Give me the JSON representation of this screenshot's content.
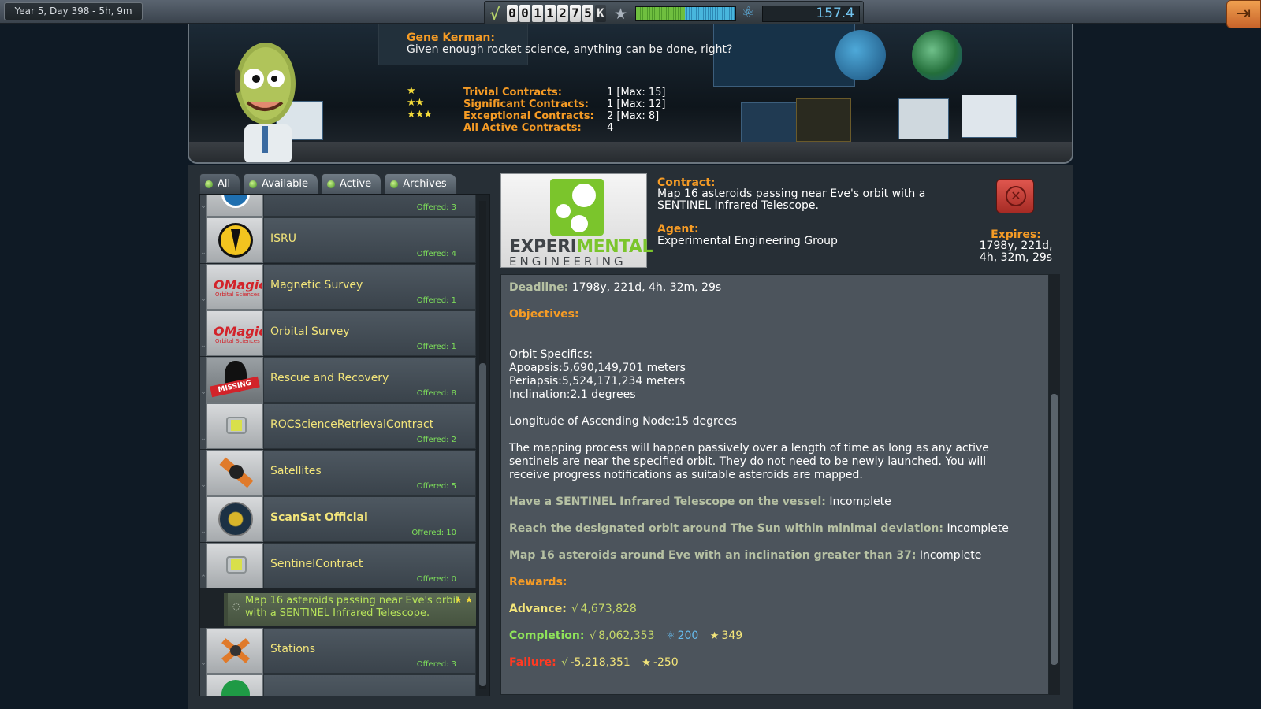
{
  "topbar": {
    "date": "Year 5, Day 398 - 5h, 9m",
    "funds_digits": [
      "0",
      "0",
      "1",
      "1",
      "2",
      "7",
      "5",
      "K"
    ],
    "science": "157.4",
    "reputation_level": 0.55,
    "icons": {
      "funds": "funds-icon",
      "reputation": "star-icon",
      "science": "science-atom-icon",
      "exit": "exit-icon"
    }
  },
  "header": {
    "speaker": "Gene Kerman:",
    "quote": "Given enough rocket science, anything can be done, right?",
    "summary": [
      {
        "stars": "★",
        "label": "Trivial Contracts:",
        "value": "1  [Max: 15]"
      },
      {
        "stars": "★★",
        "label": "Significant Contracts:",
        "value": "1  [Max: 12]"
      },
      {
        "stars": "★★★",
        "label": "Exceptional Contracts:",
        "value": "2  [Max: 8]"
      },
      {
        "stars": "",
        "label": "All Active Contracts:",
        "value": "4"
      }
    ]
  },
  "tabs": [
    "All",
    "Available",
    "Active",
    "Archives"
  ],
  "list": {
    "rows": [
      {
        "title": "",
        "offered": "Offered: 3",
        "icon": "agency-logo-icon"
      },
      {
        "title": "ISRU",
        "offered": "Offered: 4",
        "icon": "isru-drill-icon"
      },
      {
        "title": "Magnetic Survey",
        "offered": "Offered: 1",
        "icon": "omagic-logo-icon"
      },
      {
        "title": "Orbital Survey",
        "offered": "Offered: 1",
        "icon": "omagic-logo-icon"
      },
      {
        "title": "Rescue and Recovery",
        "offered": "Offered: 8",
        "icon": "missing-kerbal-icon"
      },
      {
        "title": "ROCScienceRetrievalContract",
        "offered": "Offered: 2",
        "icon": "probe-icon"
      },
      {
        "title": "Satellites",
        "offered": "Offered: 5",
        "icon": "satellite-icon"
      },
      {
        "title": "ScanSat Official",
        "offered": "Offered: 10",
        "icon": "scansat-logo-icon"
      },
      {
        "title": "SentinelContract",
        "offered": "Offered: 0",
        "icon": "probe-icon"
      },
      {
        "title": "Stations",
        "offered": "Offered: 3",
        "icon": "station-icon"
      }
    ],
    "selected_contract": {
      "text": "Map 16 asteroids passing near Eve's orbit with a SENTINEL Infrared Telescope.",
      "stars": "★ ★"
    }
  },
  "detail": {
    "agency_logo": {
      "word1a": "EXPERI",
      "word1b": "MENTAL",
      "word2": "ENGINEERING"
    },
    "contract_label": "Contract:",
    "contract_text": "Map 16 asteroids passing near Eve's orbit with a SENTINEL Infrared Telescope.",
    "agent_label": "Agent:",
    "agent_text": "Experimental Engineering Group",
    "expires_label": "Expires:",
    "expires_value": "1798y, 221d, 4h, 32m, 29s",
    "deadline_label": "Deadline:",
    "deadline_value": "1798y, 221d, 4h, 32m, 29s",
    "objectives_label": "Objectives:",
    "orbit_specifics": "Orbit Specifics:",
    "apoapsis": "Apoapsis:5,690,149,701 meters",
    "periapsis": "Periapsis:5,524,171,234 meters",
    "inclination": "Inclination:2.1 degrees",
    "lan": "Longitude of Ascending Node:15 degrees",
    "description": "The mapping process will happen passively over a length of time as long as any active sentinels are near the specified orbit. They do not need to be newly launched. You will receive progress notifications as suitable asteroids are mapped.",
    "objectives": [
      {
        "label": "Have a SENTINEL Infrared Telescope on the vessel:",
        "status": "Incomplete"
      },
      {
        "label": "Reach the designated orbit around The Sun within minimal deviation:",
        "status": "Incomplete"
      },
      {
        "label": "Map 16 asteroids around Eve with an inclination greater than 37:",
        "status": "Incomplete"
      }
    ],
    "rewards_label": "Rewards:",
    "advance_label": "Advance:",
    "advance_funds": "4,673,828",
    "completion_label": "Completion:",
    "completion_funds": "8,062,353",
    "completion_science": "200",
    "completion_rep": "349",
    "failure_label": "Failure:",
    "failure_funds": "-5,218,351",
    "failure_rep": "-250",
    "colors": {
      "accent_orange": "#f59b25",
      "list_title": "#f3e57a",
      "offered_green": "#7ee05a",
      "failure_red": "#ff3a22"
    }
  }
}
